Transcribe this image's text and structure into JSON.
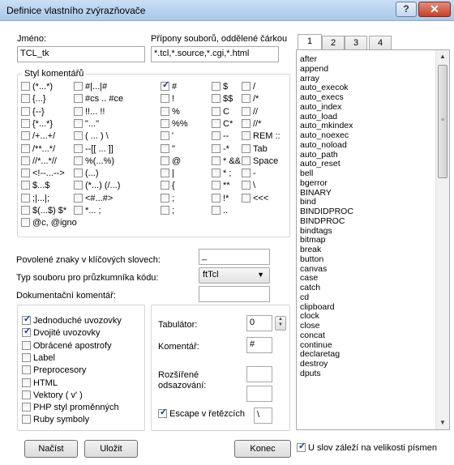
{
  "window": {
    "title": "Definice vlastního zvýrazňovače",
    "help_label": "?",
    "close_label": "✕"
  },
  "name_field": {
    "label": "Jméno:",
    "value": "TCL_tk"
  },
  "extensions_field": {
    "label": "Přípony souborů, oddělené čárkou",
    "value": "*.tcl,*.source,*.cgi,*.html"
  },
  "comment_styles": {
    "title": "Styl komentářů",
    "columns": [
      {
        "items": [
          {
            "label": "(*...*)",
            "checked": false
          },
          {
            "label": "{...}",
            "checked": false
          },
          {
            "label": "{--}",
            "checked": false
          },
          {
            "label": "{*...*}",
            "checked": false
          },
          {
            "label": "/+...+/",
            "checked": false
          },
          {
            "label": "/**...*/",
            "checked": false
          },
          {
            "label": "//*...*//",
            "checked": false
          },
          {
            "label": "<!--...-->",
            "checked": false
          },
          {
            "label": "$...$",
            "checked": false
          },
          {
            "label": ";|...|;",
            "checked": false
          },
          {
            "label": "$(...$) $*",
            "checked": false
          },
          {
            "label": "@c, @igno",
            "checked": false
          }
        ]
      },
      {
        "items": [
          {
            "label": "#|...|#",
            "checked": false
          },
          {
            "label": "#cs .. #ce",
            "checked": false
          },
          {
            "label": "!!... !!",
            "checked": false
          },
          {
            "label": "\"...\"",
            "checked": false
          },
          {
            "label": "( ... ) \\",
            "checked": false
          },
          {
            "label": "--[[ ... ]]",
            "checked": false
          },
          {
            "label": "%(...%)",
            "checked": false
          },
          {
            "label": "(...)",
            "checked": false
          },
          {
            "label": "(*...) (/...)",
            "checked": false
          },
          {
            "label": "<#...#>",
            "checked": false
          },
          {
            "label": "*... ;",
            "checked": false
          }
        ]
      },
      {
        "items": [
          {
            "label": "#",
            "checked": true
          },
          {
            "label": "!",
            "checked": false
          },
          {
            "label": "%",
            "checked": false
          },
          {
            "label": "%%",
            "checked": false
          },
          {
            "label": "'",
            "checked": false
          },
          {
            "label": "\"",
            "checked": false
          },
          {
            "label": "@",
            "checked": false
          },
          {
            "label": "|",
            "checked": false
          },
          {
            "label": "{",
            "checked": false
          },
          {
            "label": ";",
            "checked": false
          },
          {
            "label": ";",
            "checked": false
          }
        ]
      },
      {
        "items": [
          {
            "label": "$",
            "checked": false
          },
          {
            "label": "$$",
            "checked": false
          },
          {
            "label": "C",
            "checked": false
          },
          {
            "label": "C*",
            "checked": false
          },
          {
            "label": "--",
            "checked": false
          },
          {
            "label": "-*",
            "checked": false
          },
          {
            "label": "* &&",
            "checked": false
          },
          {
            "label": "* ;",
            "checked": false
          },
          {
            "label": "**",
            "checked": false
          },
          {
            "label": "!*",
            "checked": false
          },
          {
            "label": "..",
            "checked": false
          }
        ]
      },
      {
        "items": [
          {
            "label": "/",
            "checked": false
          },
          {
            "label": "/*",
            "checked": false
          },
          {
            "label": "//",
            "checked": false
          },
          {
            "label": "//*",
            "checked": false
          },
          {
            "label": "REM ::",
            "checked": false
          },
          {
            "label": "Tab",
            "checked": false
          },
          {
            "label": "Space",
            "checked": false
          },
          {
            "label": "-",
            "checked": false
          },
          {
            "label": "\\",
            "checked": false
          },
          {
            "label": "<<<",
            "checked": false
          }
        ]
      }
    ]
  },
  "keyword_chars": {
    "label": "Povolené znaky v klíčových slovech:",
    "value": "_"
  },
  "file_type": {
    "label": "Typ souboru pro průzkumníka kódu:",
    "value": "ftTcl"
  },
  "doc_comment": {
    "label": "Dokumentační komentář:",
    "value": ""
  },
  "quote_options": [
    {
      "label": "Jednoduché uvozovky",
      "checked": true
    },
    {
      "label": "Dvojité uvozovky",
      "checked": true
    },
    {
      "label": "Obrácené apostrofy",
      "checked": false
    },
    {
      "label": "Label",
      "checked": false
    },
    {
      "label": "Preprocesory",
      "checked": false
    },
    {
      "label": "HTML",
      "checked": false
    },
    {
      "label": "Vektory ( v' )",
      "checked": false
    },
    {
      "label": "PHP styl proměnných",
      "checked": false
    },
    {
      "label": "Ruby symboly",
      "checked": false
    }
  ],
  "tabulator": {
    "label": "Tabulátor:",
    "value": "0"
  },
  "comment": {
    "label": "Komentář:",
    "value": "#"
  },
  "indent": {
    "label": "Rozšířené odsazování:",
    "value_1": "",
    "value_2": ""
  },
  "escape": {
    "label": "Escape v řetězcích",
    "checked": true,
    "value": "\\"
  },
  "tabs": [
    "1",
    "2",
    "3",
    "4"
  ],
  "keywords": [
    "after",
    "append",
    "array",
    "auto_execok",
    "auto_execs",
    "auto_index",
    "auto_load",
    "auto_mkindex",
    "auto_noexec",
    "auto_noload",
    "auto_path",
    "auto_reset",
    "bell",
    "bgerror",
    "BINARY",
    "bind",
    "BINDIDPROC",
    "BINDPROC",
    "bindtags",
    "bitmap",
    "break",
    "button",
    "canvas",
    "case",
    "catch",
    "cd",
    "clipboard",
    "clock",
    "close",
    "concat",
    "continue",
    "declaretag",
    "destroy",
    "dputs"
  ],
  "buttons": {
    "load": "Načíst",
    "save": "Uložit",
    "close": "Konec"
  },
  "case_sensitive": {
    "label": "U slov záleží na velikosti písmen",
    "checked": true
  }
}
